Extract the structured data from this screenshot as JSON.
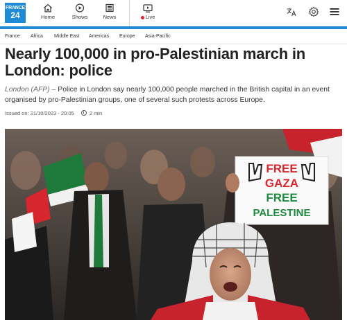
{
  "brand": {
    "line1": "FRANCE",
    "line2": "24"
  },
  "nav": {
    "home": "Home",
    "shows": "Shows",
    "news": "News",
    "live": "Live"
  },
  "sections": [
    "France",
    "Africa",
    "Middle East",
    "Americas",
    "Europe",
    "Asia-Pacific"
  ],
  "article": {
    "title": "Nearly 100,000 in pro-Palestinian march in London: police",
    "source": "London (AFP)",
    "separator": " – ",
    "lead": "Police in London say nearly 100,000 people marched in the British capital in an event organised by pro-Palestinian groups, one of several such protests across Europe.",
    "issued": "Issued on: 21/10/2023 - 20:05",
    "read_time": "2 min"
  },
  "photo": {
    "sign_line1": "FREE",
    "sign_line2": "GAZA",
    "sign_line3": "FREE",
    "sign_line4": "PALESTINE"
  },
  "colors": {
    "accent": "#1f8ad6",
    "live": "#e0202a",
    "sign_red": "#d7262e",
    "sign_green": "#1d8a3e"
  }
}
